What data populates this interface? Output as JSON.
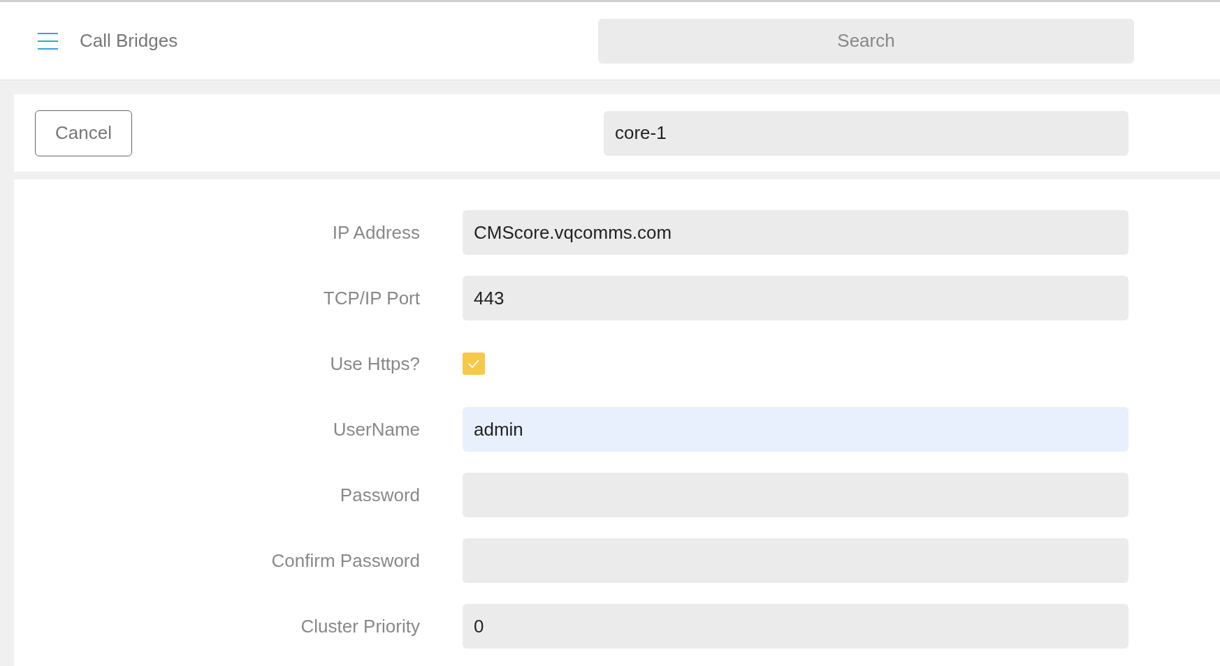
{
  "header": {
    "title": "Call Bridges",
    "search": {
      "placeholder": "Search"
    }
  },
  "toolbar": {
    "cancel": "Cancel",
    "name_field": {
      "value": "core-1"
    }
  },
  "form": [
    {
      "kind": "text",
      "label": "IP Address",
      "value": "CMScore.vqcomms.com",
      "focused": false
    },
    {
      "kind": "text",
      "label": "TCP/IP Port",
      "value": "443",
      "focused": false
    },
    {
      "kind": "checkbox",
      "label": "Use Https?",
      "checked": true
    },
    {
      "kind": "text",
      "label": "UserName",
      "value": "admin",
      "focused": true
    },
    {
      "kind": "password",
      "label": "Password",
      "focused": false
    },
    {
      "kind": "password",
      "label": "Confirm Password",
      "focused": false
    },
    {
      "kind": "text",
      "label": "Cluster Priority",
      "value": "0",
      "focused": false
    }
  ]
}
